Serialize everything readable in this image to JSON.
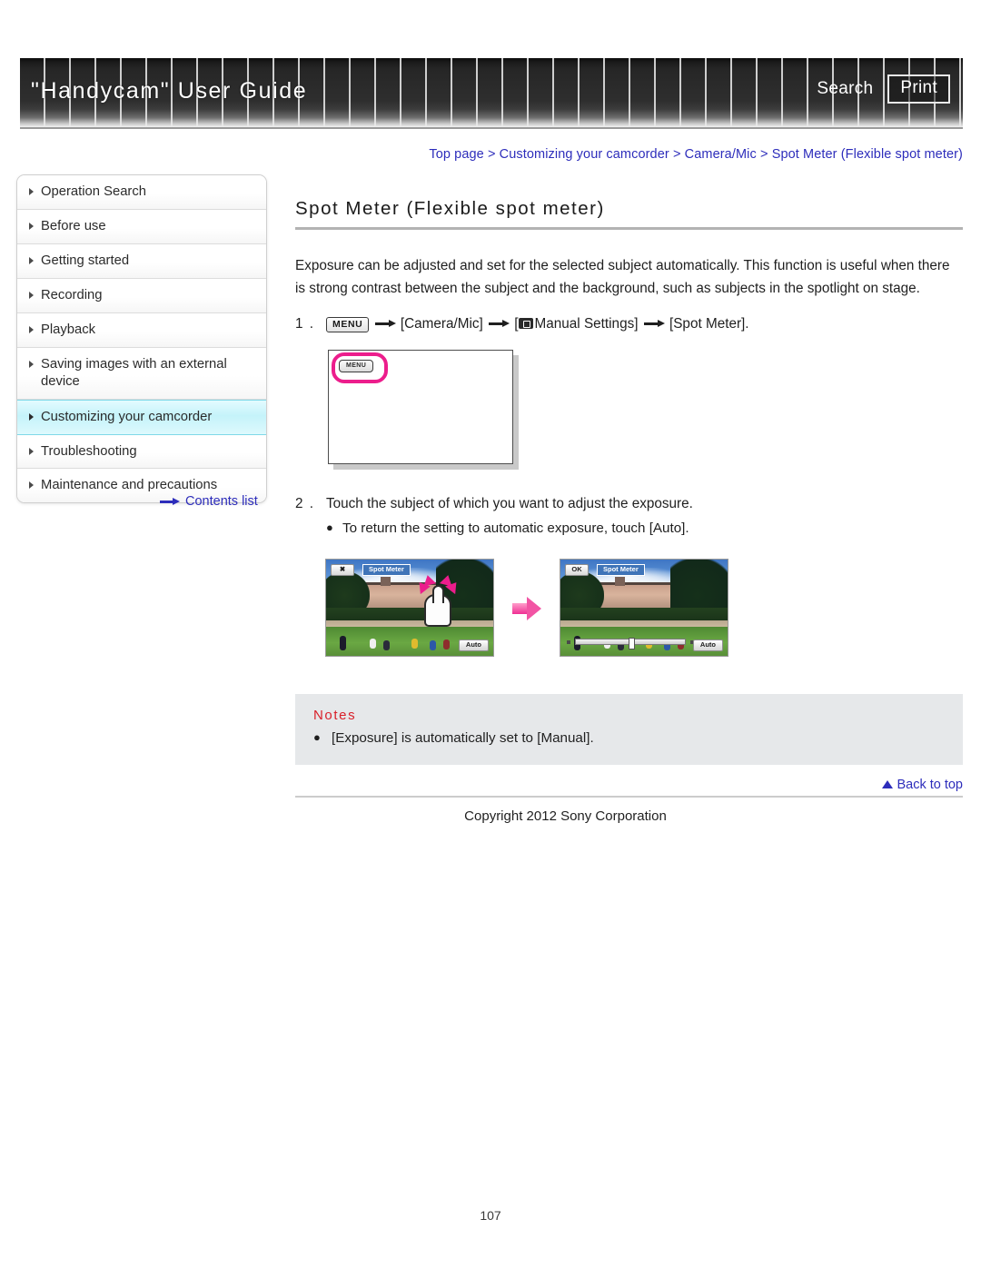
{
  "header": {
    "title": "\"Handycam\" User Guide",
    "search_label": "Search",
    "print_label": "Print"
  },
  "breadcrumb": {
    "items": [
      "Top page",
      "Customizing your camcorder",
      "Camera/Mic",
      "Spot Meter (Flexible spot meter)"
    ],
    "separator": ">",
    "full": "Top page > Customizing your camcorder > Camera/Mic > Spot Meter (Flexible spot meter)"
  },
  "sidebar": {
    "items": [
      {
        "label": "Operation Search",
        "active": false
      },
      {
        "label": "Before use",
        "active": false
      },
      {
        "label": "Getting started",
        "active": false
      },
      {
        "label": "Recording",
        "active": false
      },
      {
        "label": "Playback",
        "active": false
      },
      {
        "label": "Saving images with an external device",
        "active": false
      },
      {
        "label": "Customizing your camcorder",
        "active": true
      },
      {
        "label": "Troubleshooting",
        "active": false
      },
      {
        "label": "Maintenance and precautions",
        "active": false
      }
    ],
    "contents_link": "Contents list"
  },
  "main": {
    "title": "Spot Meter (Flexible spot meter)",
    "intro": "Exposure can be adjusted and set for the selected subject automatically. This function is useful when there is strong contrast between the subject and the background, such as subjects in the spotlight on stage.",
    "step1": {
      "number": "1 .",
      "menu_chip": "MENU",
      "part_camera_mic": "[Camera/Mic]",
      "part_manual": "Manual Settings]",
      "part_manual_open": "[",
      "part_spot_meter": "[Spot Meter]."
    },
    "menu_figure": {
      "button_label": "MENU",
      "highlight_color": "#ec1d8c"
    },
    "step2": {
      "number": "2 .",
      "text": "Touch the subject of which you want to adjust the exposure.",
      "bullet": "To return the setting to automatic exposure, touch [Auto]."
    },
    "camera_figures": {
      "left": {
        "close_label": "✖",
        "title_label": "Spot Meter",
        "auto_label": "Auto"
      },
      "right": {
        "ok_label": "OK",
        "title_label": "Spot Meter",
        "auto_label": "Auto"
      }
    },
    "notes": {
      "heading": "Notes",
      "items": [
        "[Exposure] is automatically set to [Manual]."
      ]
    },
    "back_to_top": "Back to top",
    "copyright": "Copyright 2012 Sony Corporation"
  },
  "page_number": "107"
}
